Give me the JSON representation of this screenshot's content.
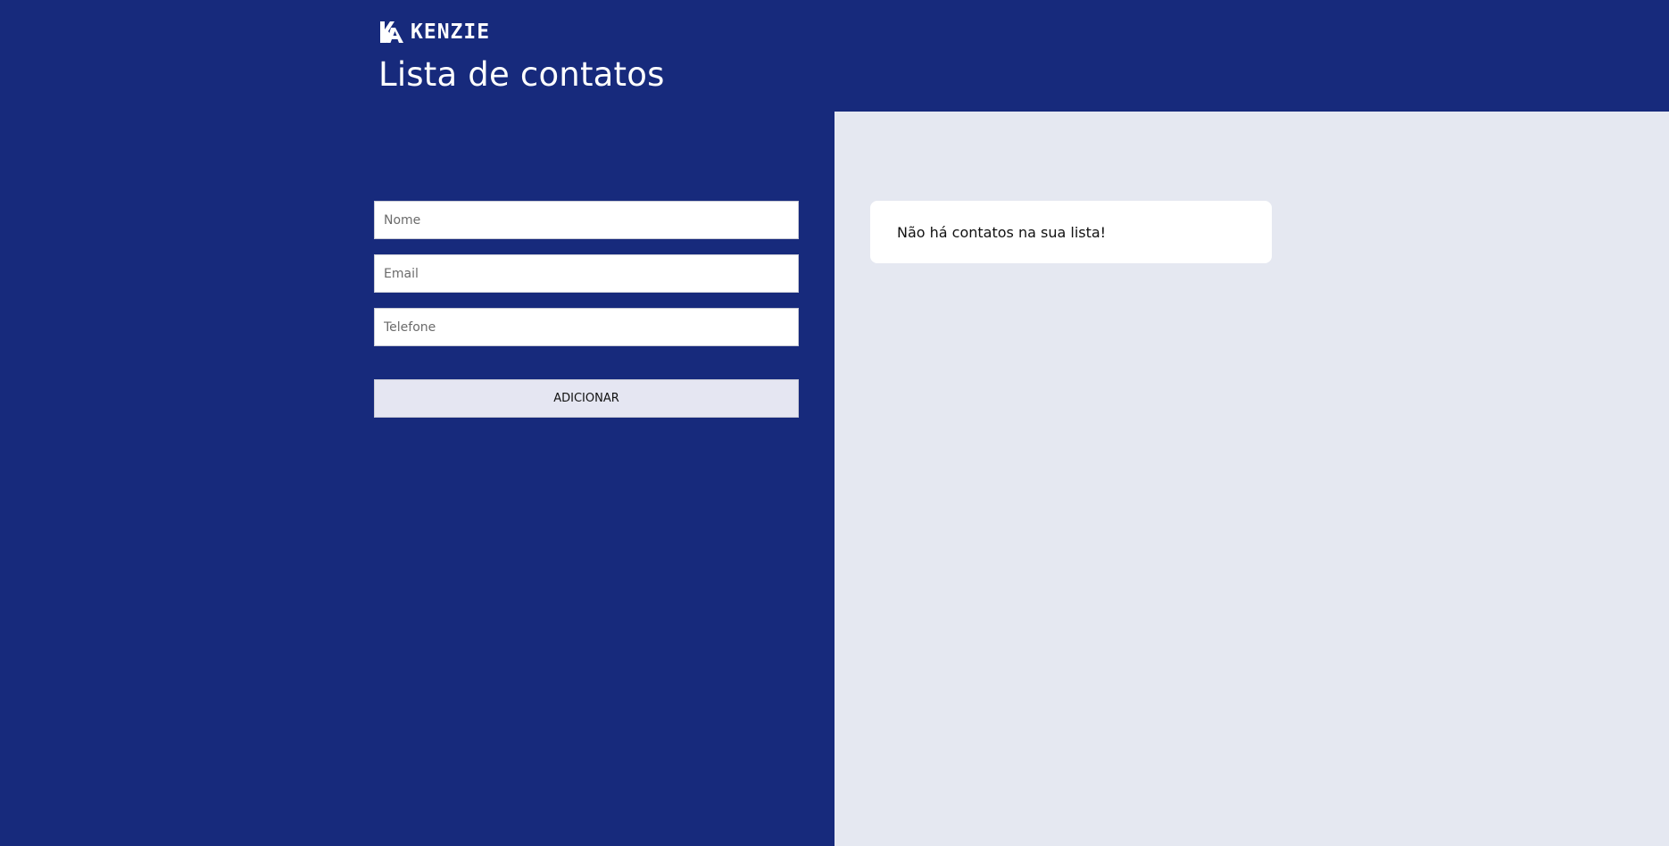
{
  "brand": {
    "name": "KENZIE",
    "logo_icon": "kenzie-ka-logo-icon"
  },
  "header": {
    "title": "Lista de contatos"
  },
  "form": {
    "name_placeholder": "Nome",
    "email_placeholder": "Email",
    "phone_placeholder": "Telefone",
    "submit_label": "ADICIONAR"
  },
  "contacts": {
    "empty_message": "Não há contatos na sua lista!"
  },
  "colors": {
    "primary": "#172a7c",
    "panel": "#e5e8f1",
    "button": "#e5e6f2",
    "card": "#ffffff"
  }
}
